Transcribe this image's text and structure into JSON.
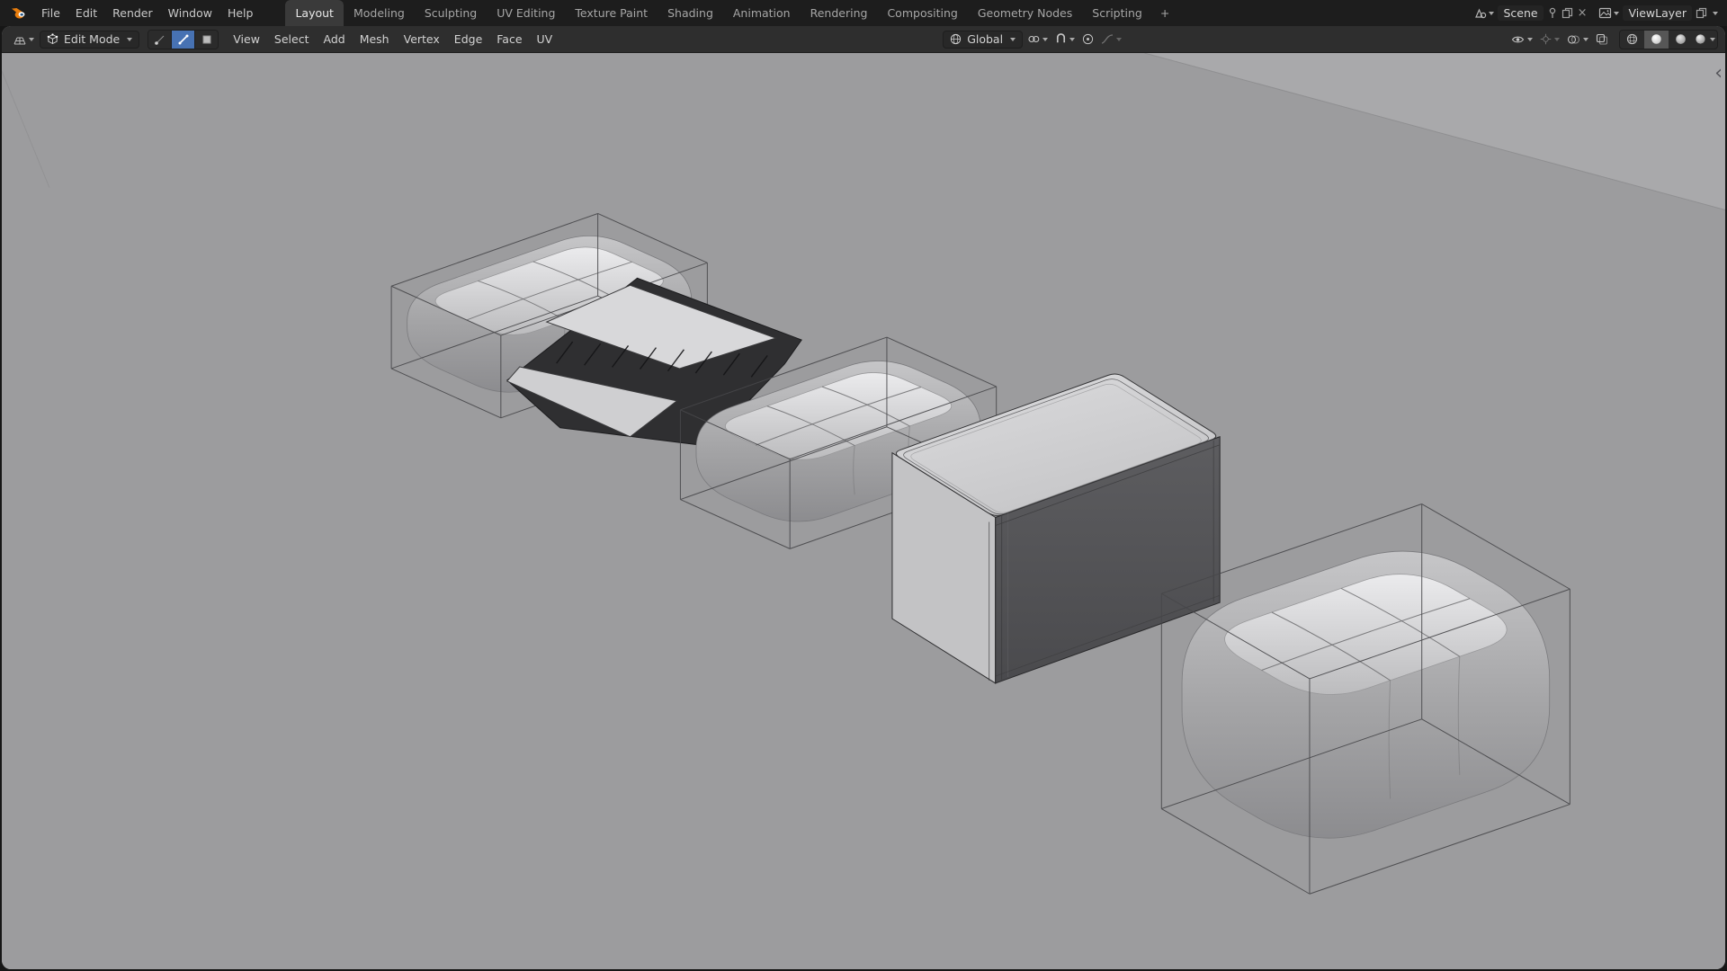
{
  "colors": {
    "accent_blue": "#4772b3",
    "topbar_bg": "#1d1d1d",
    "header_bg": "#2e2e2e",
    "viewport_bg": "#9c9c9e",
    "blender_orange": "#e87d0d"
  },
  "icons": {
    "close_glyph": "×",
    "chevron_glyph": "‹"
  },
  "topbar": {
    "app_menus": [
      "File",
      "Edit",
      "Render",
      "Window",
      "Help"
    ],
    "workspace_tabs": [
      "Layout",
      "Modeling",
      "Sculpting",
      "UV Editing",
      "Texture Paint",
      "Shading",
      "Animation",
      "Rendering",
      "Compositing",
      "Geometry Nodes",
      "Scripting"
    ],
    "active_tab": "Layout",
    "add_tab": "+",
    "scene": {
      "value": "Scene"
    },
    "view_layer": {
      "value": "ViewLayer"
    }
  },
  "viewport_header": {
    "mode": "Edit Mode",
    "menus": [
      "View",
      "Select",
      "Add",
      "Mesh",
      "Vertex",
      "Edge",
      "Face",
      "UV"
    ],
    "orientation": "Global"
  },
  "viewport": {
    "objects": [
      "rounded-box-beveled",
      "flattened-dark-slab",
      "rounded-box-mid",
      "beveled-solid-box",
      "rounded-box-large"
    ]
  }
}
